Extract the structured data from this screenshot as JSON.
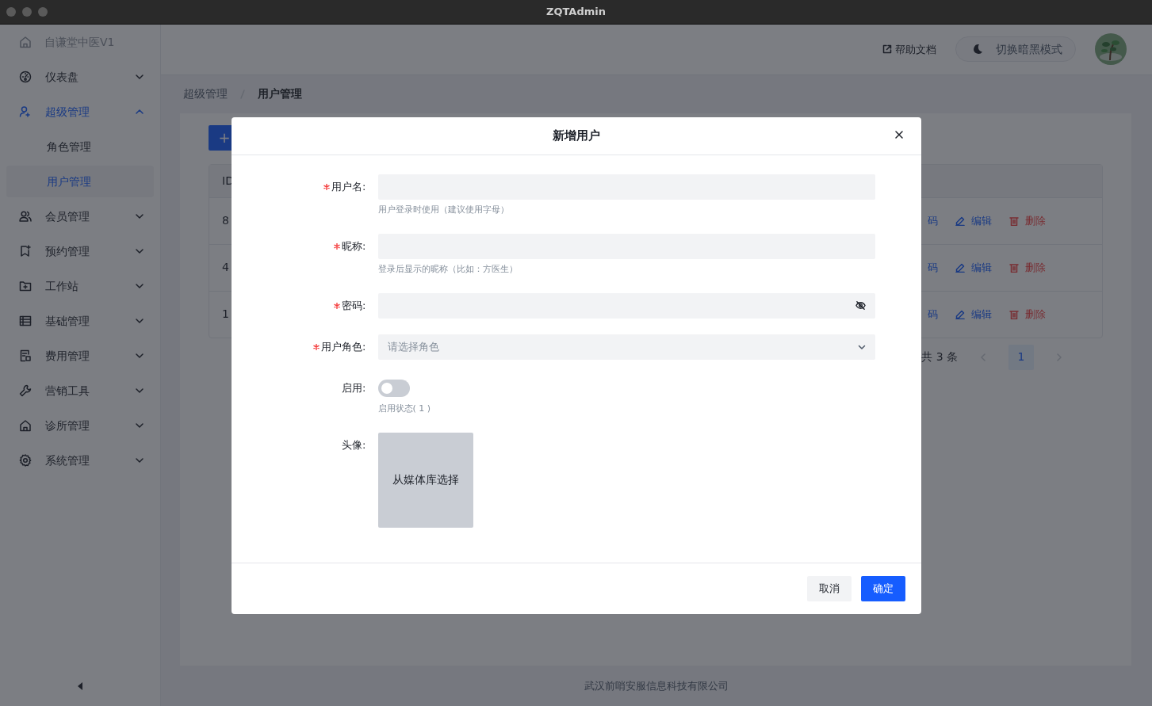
{
  "window": {
    "title": "ZQTAdmin"
  },
  "sidebar": {
    "brand": "自谦堂中医V1",
    "items": [
      {
        "label": "仪表盘",
        "selected": false,
        "expanded": false
      },
      {
        "label": "超级管理",
        "selected": true,
        "expanded": true,
        "children": [
          {
            "label": "角色管理",
            "selected": false
          },
          {
            "label": "用户管理",
            "selected": true
          }
        ]
      },
      {
        "label": "会员管理",
        "selected": false,
        "expanded": false
      },
      {
        "label": "预约管理",
        "selected": false,
        "expanded": false
      },
      {
        "label": "工作站",
        "selected": false,
        "expanded": false
      },
      {
        "label": "基础管理",
        "selected": false,
        "expanded": false
      },
      {
        "label": "费用管理",
        "selected": false,
        "expanded": false
      },
      {
        "label": "营销工具",
        "selected": false,
        "expanded": false
      },
      {
        "label": "诊所管理",
        "selected": false,
        "expanded": false
      },
      {
        "label": "系统管理",
        "selected": false,
        "expanded": false
      }
    ]
  },
  "header": {
    "help_link": "帮助文档",
    "theme_button": "切换暗黑模式"
  },
  "breadcrumb": [
    "超级管理",
    "用户管理"
  ],
  "add_button": "+",
  "table": {
    "column_1": "ID",
    "rows": [
      {
        "column_1": "8",
        "column_2": "码",
        "edit": "编辑",
        "delete": "删除"
      },
      {
        "column_1": "4",
        "column_2": "码",
        "edit": "编辑",
        "delete": "删除"
      },
      {
        "column_1": "1",
        "column_2": "码",
        "edit": "编辑",
        "delete": "删除"
      }
    ]
  },
  "pagination": {
    "total": "共 3 条",
    "pages": [
      {
        "label": "1",
        "selected": true
      }
    ]
  },
  "footer": "武汉前哨安服信息科技有限公司",
  "dialog": {
    "title": "新增用户",
    "fields": [
      {
        "kind": "text",
        "label": "用户名:",
        "required": true,
        "hint": "用户登录时使用（建议使用字母）"
      },
      {
        "kind": "text",
        "label": "昵称:",
        "required": true,
        "hint": "登录后显示的昵称（比如：方医生）"
      },
      {
        "kind": "password",
        "label": "密码:",
        "required": true
      },
      {
        "kind": "select",
        "label": "用户角色:",
        "required": true,
        "placeholder": "请选择角色"
      },
      {
        "kind": "switch",
        "label": "启用:",
        "required": false,
        "on": false,
        "hint": "启用状态( 1 )"
      },
      {
        "kind": "upload",
        "label": "头像:",
        "required": false,
        "button": "从媒体库选择"
      }
    ],
    "buttons": [
      {
        "label": "取消",
        "kind": "default"
      },
      {
        "label": "确定",
        "kind": "primary"
      }
    ]
  }
}
